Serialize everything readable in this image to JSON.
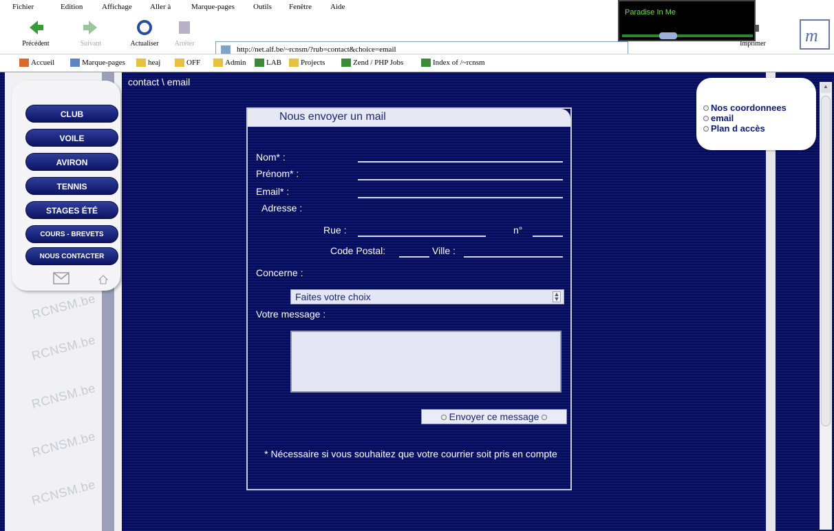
{
  "menu": [
    "Fichier",
    "Edition",
    "Affichage",
    "Aller à",
    "Marque-pages",
    "Outils",
    "Fenêtre",
    "Aide"
  ],
  "nav": {
    "back": "Précédent",
    "forward": "Suivant",
    "reload": "Actualiser",
    "stop": "Arrêter",
    "print": "Imprimer"
  },
  "url": "http://net.alf.be/~rcnsm/?rub=contact&choice=email",
  "overlay_title": "Paradise In Me",
  "bookmarks": [
    "Accueil",
    "Marque-pages",
    "heaj",
    "OFF",
    "Admin",
    "LAB",
    "Projects",
    "Zend / PHP Jobs",
    "Index of /~rcnsm"
  ],
  "breadcrumb": "contact \\ email",
  "side_menu": [
    "Club",
    "Voile",
    "Aviron",
    "Tennis",
    "Stages été",
    "Cours - Brevets",
    "Nous contacter"
  ],
  "watermark": "RCNSM.be",
  "form": {
    "title": "Nous envoyer un mail",
    "nom": "Nom* :",
    "prenom": "Prénom* :",
    "email": "Email* :",
    "adresse": "Adresse :",
    "rue": "Rue :",
    "no": "n°",
    "cp": "Code Postal:",
    "ville": "Ville :",
    "concerne": "Concerne :",
    "select_value": "Faites votre choix",
    "message": "Votre message :",
    "send": "Envoyer ce message",
    "note": "* Nécessaire si vous souhaitez que votre courrier soit pris en compte"
  },
  "right_links": [
    "Nos coordonnees",
    "email",
    "Plan d accès"
  ],
  "colors": {
    "bg": "#0a1160",
    "accent": "#1a2770"
  }
}
